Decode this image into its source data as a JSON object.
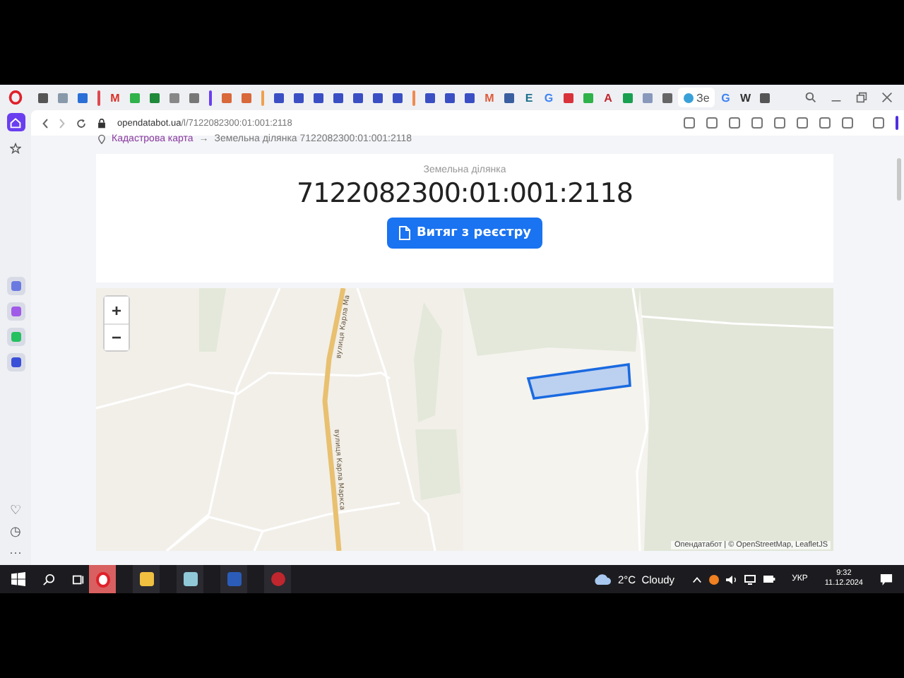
{
  "tabs": [
    {
      "kind": "icon",
      "color": "#555555",
      "selected": false
    },
    {
      "kind": "icon",
      "color": "#8899aa",
      "selected": false
    },
    {
      "kind": "icon",
      "color": "#2a6fd6",
      "selected": false
    },
    {
      "kind": "group",
      "color": "#e0484e"
    },
    {
      "kind": "letter",
      "label": "M",
      "color": "#d93025",
      "selected": false
    },
    {
      "kind": "icon",
      "color": "#2fb24a",
      "selected": false
    },
    {
      "kind": "icon",
      "color": "#1f8a3a",
      "selected": false
    },
    {
      "kind": "icon",
      "color": "#888888",
      "selected": false
    },
    {
      "kind": "icon",
      "color": "#777777",
      "selected": false
    },
    {
      "kind": "group",
      "color": "#6a3ef0"
    },
    {
      "kind": "icon",
      "color": "#d9683a",
      "selected": false
    },
    {
      "kind": "icon",
      "color": "#d9683a",
      "selected": false
    },
    {
      "kind": "group",
      "color": "#f0a050"
    },
    {
      "kind": "icon",
      "color": "#3b4fc4",
      "selected": false
    },
    {
      "kind": "icon",
      "color": "#3b4fc4",
      "selected": false
    },
    {
      "kind": "icon",
      "color": "#3b4fc4",
      "selected": false
    },
    {
      "kind": "icon",
      "color": "#3b4fc4",
      "selected": false
    },
    {
      "kind": "icon",
      "color": "#3b4fc4",
      "selected": false
    },
    {
      "kind": "icon",
      "color": "#3b4fc4",
      "selected": false
    },
    {
      "kind": "icon",
      "color": "#3b4fc4",
      "selected": false
    },
    {
      "kind": "group",
      "color": "#f08a50"
    },
    {
      "kind": "icon",
      "color": "#3b4fc4",
      "selected": false
    },
    {
      "kind": "icon",
      "color": "#3b4fc4",
      "selected": false
    },
    {
      "kind": "icon",
      "color": "#3b4fc4",
      "selected": false
    },
    {
      "kind": "letter",
      "label": "M",
      "color": "#e05a3a",
      "selected": false
    },
    {
      "kind": "icon",
      "color": "#3a5fa0",
      "selected": false
    },
    {
      "kind": "letter",
      "label": "E",
      "color": "#1a6f8a",
      "selected": false
    },
    {
      "kind": "letter",
      "label": "G",
      "color": "#4285f4",
      "selected": false
    },
    {
      "kind": "icon",
      "color": "#d9323a",
      "selected": false
    },
    {
      "kind": "icon",
      "color": "#2fb24a",
      "selected": false
    },
    {
      "kind": "letter",
      "label": "A",
      "color": "#c0262d",
      "selected": false
    },
    {
      "kind": "icon",
      "color": "#18a050",
      "selected": false
    },
    {
      "kind": "icon",
      "color": "#8899bb",
      "selected": false
    },
    {
      "kind": "icon",
      "color": "#666666",
      "selected": false
    },
    {
      "kind": "text",
      "label": "Зе",
      "color": "#3aa0d8",
      "selected": true
    },
    {
      "kind": "letter",
      "label": "G",
      "color": "#4285f4",
      "selected": false
    },
    {
      "kind": "letter",
      "label": "W",
      "color": "#333333",
      "selected": false
    },
    {
      "kind": "icon",
      "color": "#555555",
      "selected": false
    }
  ],
  "address_bar": {
    "host": "opendatabot.ua",
    "path": "/l/7122082300:01:001:2118"
  },
  "sidebar": {
    "items": [
      {
        "kind": "home",
        "selected": true
      },
      {
        "kind": "star",
        "selected": false
      },
      {
        "kind": "app",
        "color": "#6a7ae0",
        "selected": false
      },
      {
        "kind": "app",
        "color": "#a05ae8",
        "selected": false
      },
      {
        "kind": "app",
        "color": "#25c060",
        "selected": false
      },
      {
        "kind": "app",
        "color": "#3a4fd8",
        "selected": false
      }
    ],
    "bottom": [
      "♡",
      "◷",
      "···"
    ]
  },
  "breadcrumb": {
    "link": "Кадастрова карта",
    "separator": "→",
    "current": "Земельна ділянка 7122082300:01:001:2118"
  },
  "parcel": {
    "subtitle": "Земельна ділянка",
    "number": "7122082300:01:001:2118",
    "button": "Витяг з реєстру"
  },
  "map": {
    "zoom_in": "+",
    "zoom_out": "−",
    "streets": [
      "вулиця Карла Ма",
      "вулиця Карла Маркса"
    ],
    "attribution": "Опендатабот | © OpenStreetMap, LeafletJS"
  },
  "taskbar": {
    "apps": [
      {
        "kind": "opera",
        "selected": true
      },
      {
        "kind": "explorer",
        "selected": false
      },
      {
        "kind": "app",
        "selected": false
      },
      {
        "kind": "word",
        "selected": false
      },
      {
        "kind": "red",
        "selected": false
      }
    ],
    "weather": "2°C  Cloudy",
    "language": "УКР",
    "time": "9:32",
    "date": "11.12.2024"
  }
}
